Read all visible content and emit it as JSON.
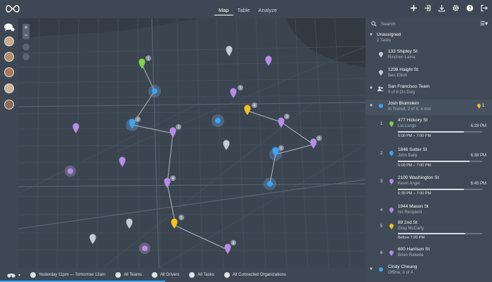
{
  "app": {
    "tabs": [
      {
        "label": "Map",
        "active": true
      },
      {
        "label": "Table",
        "active": false
      },
      {
        "label": "Analyze",
        "active": false
      }
    ],
    "tools": [
      "plus-icon",
      "import-icon",
      "download-icon",
      "gear-icon",
      "help-icon",
      "logout-icon"
    ],
    "colors": {
      "accent_blue": "#3ba4f5",
      "green": "#7fd24a",
      "yellow": "#f4c21a",
      "purple": "#b78ce8",
      "grey": "#aab3bc"
    }
  },
  "search": {
    "placeholder": "Search"
  },
  "unassigned": {
    "title": "Unassigned",
    "subtitle": "2 Tasks",
    "tasks": [
      {
        "address": "133 Shipley St",
        "name": "Rinchen Lama"
      },
      {
        "address": "1298 Haight St",
        "name": "Ben Elliott"
      }
    ]
  },
  "team": {
    "title": "San Francisco Team",
    "subtitle": "5 of 8 On Duty"
  },
  "driver1": {
    "name": "Josh Blumstein",
    "status": "In Transit, 2 of 6, 4 min",
    "badge": "1",
    "tasks": [
      {
        "num": "1",
        "address": "477 Hickory St",
        "person": "Lia Longo",
        "eta": "6:28 PM",
        "window": "6:00 PM – 7:00 PM",
        "progress": 0.78,
        "color": "green"
      },
      {
        "num": "2",
        "address": "1846 Sutter St",
        "person": "John Baily",
        "eta": "6:38 PM",
        "window": "6:00 PM – 7:00 PM",
        "progress": 0.85,
        "color": "blue"
      },
      {
        "num": "3",
        "address": "2100 Washington St",
        "person": "Kevin Angel",
        "eta": "6:45 PM",
        "window": "6:30 PM – 7:00 PM",
        "progress": 0.78,
        "color": "purple"
      },
      {
        "num": "4",
        "address": "1944 Mason St",
        "person": "No Recipient",
        "color": "purple"
      },
      {
        "num": "5",
        "address": "89 2nd St",
        "person": "Gray McCarty",
        "window": "Before 7:00 PM",
        "progress": 0.8,
        "color": "yellow"
      },
      {
        "num": "6",
        "address": "600 Harrison St",
        "person": "Brian Rakeda",
        "color": "purple"
      }
    ]
  },
  "driver2": {
    "name": "Cindy Cheung",
    "status": "Offline, 0 of 4"
  },
  "bottombar": {
    "binoculars": "binoculars-icon",
    "time_range": "Yesterday 11pm — Tomorrow 12am",
    "teams": "All Teams",
    "drivers": "All Drivers",
    "tasks": "All Tasks",
    "orgs": "All Connected Organizations"
  }
}
